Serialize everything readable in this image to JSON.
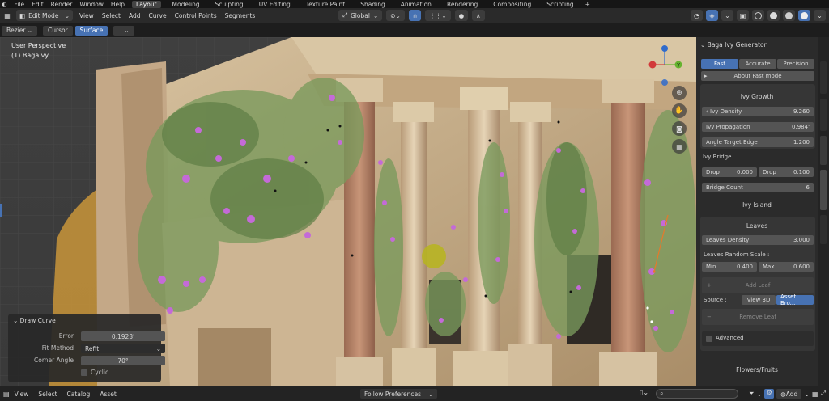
{
  "menu": {
    "items": [
      "File",
      "Edit",
      "Render",
      "Window",
      "Help"
    ],
    "workspaces": [
      "Layout",
      "Modeling",
      "Sculpting",
      "UV Editing",
      "Texture Paint",
      "Shading",
      "Animation",
      "Rendering",
      "Compositing",
      "Scripting"
    ],
    "active_workspace": "Layout",
    "add_tab": "+"
  },
  "header": {
    "mode": "Edit Mode",
    "menus": [
      "View",
      "Select",
      "Add",
      "Curve",
      "Control Points",
      "Segments"
    ],
    "transform_orientation": "Global"
  },
  "toolbar": {
    "type": "Bezier",
    "depth_options": [
      "Cursor",
      "Surface"
    ],
    "active_depth": "Surface",
    "more": "..."
  },
  "viewport": {
    "perspective": "User Perspective",
    "object": "(1) BagaIvy"
  },
  "draw_curve": {
    "title": "Draw Curve",
    "error_label": "Error",
    "error_value": "0.1923'",
    "fit_label": "Fit Method",
    "fit_value": "Refit",
    "corner_label": "Corner Angle",
    "corner_value": "70°",
    "cyclic_label": "Cyclic"
  },
  "sidebar": {
    "title": "Baga Ivy Generator",
    "modes": [
      "Fast",
      "Accurate",
      "Precision"
    ],
    "active_mode": "Fast",
    "about": "About Fast mode",
    "growth_header": "Ivy Growth",
    "ivy_density_label": "Ivy Density",
    "ivy_density": "9.260",
    "ivy_propagation_label": "Ivy Propagation",
    "ivy_propagation": "0.984'",
    "angle_target_label": "Angle Target Edge",
    "angle_target": "1.200",
    "bridge_header": "Ivy Bridge",
    "drop1_label": "Drop",
    "drop1": "0.000",
    "drop2_label": "Drop",
    "drop2": "0.100",
    "bridge_count_label": "Bridge Count",
    "bridge_count": "6",
    "island_header": "Ivy Island",
    "leaves_header": "Leaves",
    "leaves_density_label": "Leaves Density",
    "leaves_density": "3.000",
    "leaves_random_label": "Leaves Random Scale :",
    "min_label": "Min",
    "min": "0.400",
    "max_label": "Max",
    "max": "0.600",
    "add_leaf": "Add Leaf",
    "source_label": "Source :",
    "source_options": [
      "View 3D",
      "Asset Bro..."
    ],
    "active_source": "Asset Bro...",
    "remove_leaf": "Remove Leaf",
    "advanced": "Advanced",
    "flowers_header": "Flowers/Fruits",
    "tabs": [
      "Item",
      "Tool",
      "View",
      "Baga Ivy",
      "Edit"
    ]
  },
  "status": {
    "menus": [
      "View",
      "Select",
      "Catalog",
      "Asset"
    ],
    "follow": "Follow Preferences",
    "add": "Add"
  },
  "colors": {
    "accent": "#4772b3",
    "stone": "#c9b08c",
    "ivy": "#7a9a5c",
    "flower": "#c46ad8",
    "yellow_sphere": "#b7b51d"
  }
}
